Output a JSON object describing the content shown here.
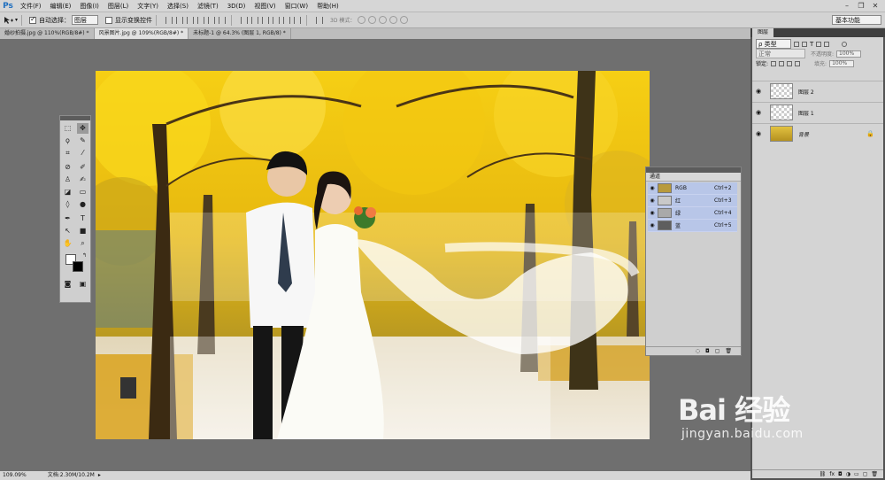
{
  "menubar": {
    "logo": "Ps",
    "items": [
      "文件(F)",
      "编辑(E)",
      "图像(I)",
      "图层(L)",
      "文字(Y)",
      "选择(S)",
      "滤镜(T)",
      "3D(D)",
      "视图(V)",
      "窗口(W)",
      "帮助(H)"
    ],
    "window_controls": [
      "–",
      "❐",
      "✕"
    ]
  },
  "optionsbar": {
    "auto_select_label": "自动选择：",
    "auto_select_value": "图层",
    "show_transform_label": "显示变换控件",
    "mode3d_label": "3D 模式：",
    "workspace": "基本功能"
  },
  "tabs": [
    {
      "label": "婚纱拍摄.jpg @ 110%(RGB/8#) *",
      "active": false
    },
    {
      "label": "风景图片.jpg @ 109%(RGB/8#) *",
      "active": true
    },
    {
      "label": "未标题-1 @ 64.3% (图层 1, RGB/8) *",
      "active": false
    }
  ],
  "status": {
    "zoom": "109.09%",
    "doc": "文档:2.30M/10.2M"
  },
  "layers_panel": {
    "tab_label": "图层",
    "kind_filter": "ρ 类型",
    "blend_mode": "正常",
    "opacity_label": "不透明度:",
    "opacity_value": "100%",
    "lock_label": "锁定:",
    "fill_label": "填充:",
    "fill_value": "100%",
    "layers": [
      {
        "name": "图层 2",
        "thumb": "checker",
        "locked": false
      },
      {
        "name": "图层 1",
        "thumb": "checker",
        "locked": false
      },
      {
        "name": "背景",
        "thumb": "bg",
        "locked": true
      }
    ],
    "footer_icons": [
      "link-icon",
      "fx-icon",
      "mask-icon",
      "adjustment-icon",
      "folder-icon",
      "new-layer-icon",
      "trash-icon"
    ]
  },
  "channels_panel": {
    "tab_label": "通道",
    "channels": [
      {
        "name": "RGB",
        "shortcut": "Ctrl+2"
      },
      {
        "name": "红",
        "shortcut": "Ctrl+3"
      },
      {
        "name": "绿",
        "shortcut": "Ctrl+4"
      },
      {
        "name": "蓝",
        "shortcut": "Ctrl+5"
      }
    ]
  },
  "watermark": {
    "brand": "Bai 经验",
    "url": "jingyan.baidu.com"
  }
}
